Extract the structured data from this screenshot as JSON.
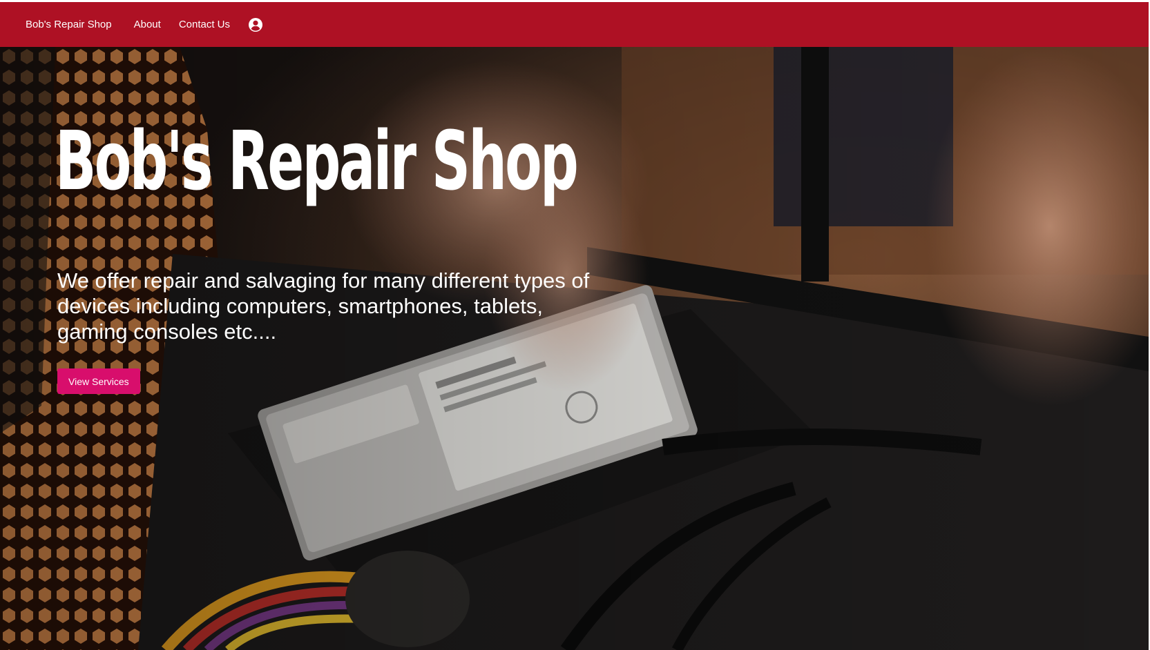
{
  "navbar": {
    "brand": "Bob's Repair Shop",
    "links": [
      "About",
      "Contact Us"
    ],
    "account_icon": "account-circle-icon",
    "background_color": "#ae1124"
  },
  "hero": {
    "title": "Bob's Repair Shop",
    "description": "We offer repair and salvaging for many different types of devices including computers, smartphones, tablets, gaming consoles etc....",
    "button_label": "View Services",
    "button_color": "#d80e6c",
    "background_image": "computer-repair-hard-drive-photo"
  }
}
